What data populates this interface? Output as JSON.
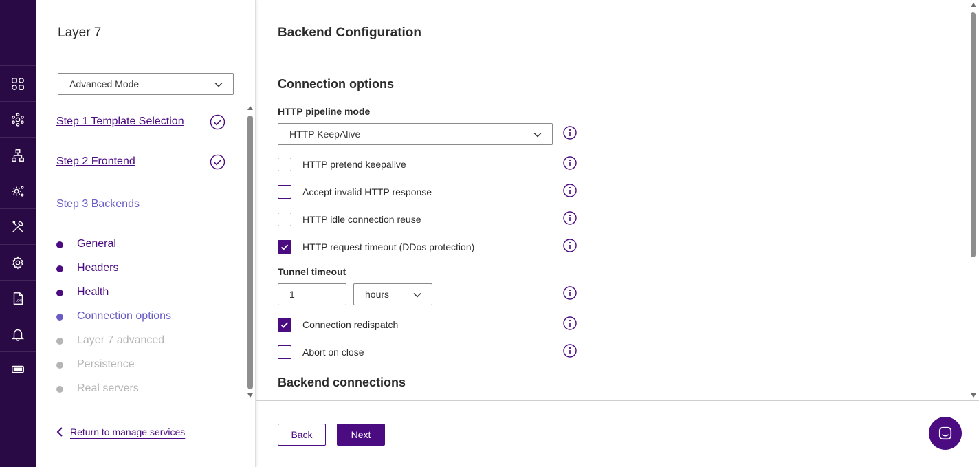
{
  "rail": {
    "icons": [
      "dashboard-icon",
      "cluster-icon",
      "network-icon",
      "settings-cog-icon",
      "tools-icon",
      "gear-icon",
      "log-file-icon",
      "bell-icon",
      "ticket-icon"
    ]
  },
  "wizard": {
    "title": "Layer 7",
    "mode_select": {
      "value": "Advanced Mode"
    },
    "steps": [
      {
        "label": "Step 1 Template Selection",
        "state": "done"
      },
      {
        "label": "Step 2 Frontend",
        "state": "done"
      },
      {
        "label": "Step 3 Backends",
        "state": "current"
      }
    ],
    "substeps": [
      {
        "label": "General",
        "state": "done"
      },
      {
        "label": "Headers",
        "state": "done"
      },
      {
        "label": "Health",
        "state": "done"
      },
      {
        "label": "Connection options",
        "state": "current"
      },
      {
        "label": "Layer 7 advanced",
        "state": "future"
      },
      {
        "label": "Persistence",
        "state": "future"
      },
      {
        "label": "Real servers",
        "state": "future"
      }
    ],
    "return_link": "Return to manage services"
  },
  "main": {
    "title": "Backend Configuration",
    "section_connection": "Connection options",
    "http_pipeline_label": "HTTP pipeline mode",
    "http_pipeline_value": "HTTP KeepAlive",
    "checkboxes_a": [
      {
        "label": "HTTP pretend keepalive",
        "checked": false
      },
      {
        "label": "Accept invalid HTTP response",
        "checked": false
      },
      {
        "label": "HTTP idle connection reuse",
        "checked": false
      },
      {
        "label": "HTTP request timeout (DDos protection)",
        "checked": true
      }
    ],
    "tunnel_label": "Tunnel timeout",
    "tunnel_value": "1",
    "tunnel_unit": "hours",
    "checkboxes_b": [
      {
        "label": "Connection redispatch",
        "checked": true
      },
      {
        "label": "Abort on close",
        "checked": false
      }
    ],
    "section_backend": "Backend connections"
  },
  "footer": {
    "back_label": "Back",
    "next_label": "Next"
  },
  "colors": {
    "brand": "#4b0c82",
    "rail_bg": "#2a0a45",
    "current_step": "#6a5cc7",
    "future_step": "#b5b5b5"
  }
}
